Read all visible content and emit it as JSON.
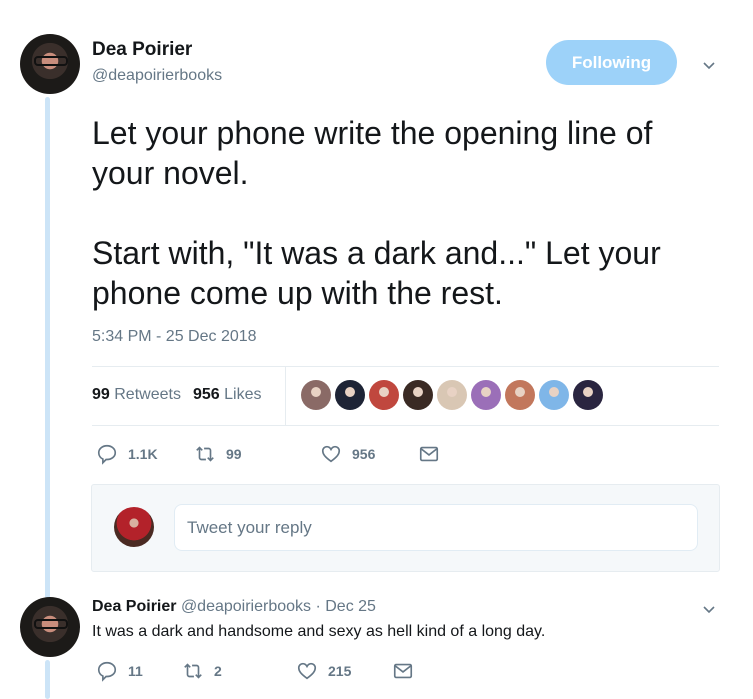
{
  "tweet": {
    "author_name": "Dea Poirier",
    "author_handle": "@deapoirierbooks",
    "follow_button": "Following",
    "text": "Let your phone write the opening line of\nyour novel.\n\nStart with, \"It was a dark and...\" Let your\nphone come up with the rest.",
    "timestamp": "5:34 PM - 25 Dec 2018",
    "stats": {
      "retweets_count": "99",
      "retweets_label": "Retweets",
      "likes_count": "956",
      "likes_label": "Likes"
    },
    "likers": [
      {
        "name": "liker-1",
        "color": "#8a6a66"
      },
      {
        "name": "liker-2",
        "color": "#1e2436"
      },
      {
        "name": "liker-3",
        "color": "#c0473e"
      },
      {
        "name": "liker-4",
        "color": "#3a2a24"
      },
      {
        "name": "liker-5",
        "color": "#d9c7b4"
      },
      {
        "name": "liker-6",
        "color": "#9b6fb8"
      },
      {
        "name": "liker-7",
        "color": "#c2775c"
      },
      {
        "name": "liker-8",
        "color": "#7fb6e8"
      },
      {
        "name": "liker-9",
        "color": "#2a2540"
      }
    ],
    "actions": {
      "replies": "1.1K",
      "retweets": "99",
      "likes": "956"
    }
  },
  "reply_composer": {
    "placeholder": "Tweet your reply"
  },
  "reply": {
    "author_name": "Dea Poirier",
    "meta": "@deapoirierbooks · Dec 25",
    "text": "It was a dark and handsome and sexy as hell kind of a long day.",
    "actions": {
      "replies": "11",
      "retweets": "2",
      "likes": "215"
    }
  },
  "colors": {
    "accent_light": "#9dd2f9",
    "thread_line": "#cce4f7",
    "muted_text": "#657786"
  }
}
